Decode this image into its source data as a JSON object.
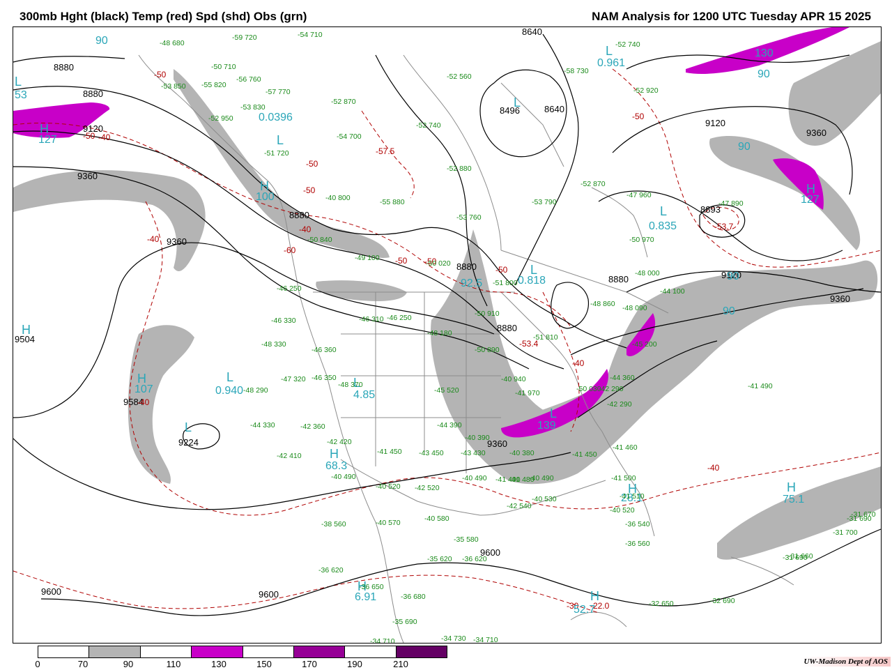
{
  "title_left": "300mb Hght (black) Temp (red) Spd (shd) Obs (grn)",
  "title_right": "NAM Analysis for 1200 UTC Tuesday  APR 15 2025",
  "credit": "UW-Madison  Dept of AOS",
  "legend": {
    "ticks": [
      "0",
      "70",
      "90",
      "110",
      "130",
      "150",
      "170",
      "190",
      "210"
    ],
    "colors": [
      "#ffffff",
      "#b4b4b4",
      "#ffffff",
      "#c800c8",
      "#ffffff",
      "#960096",
      "#ffffff",
      "#640064"
    ]
  },
  "colors": {
    "height": "#000000",
    "temp": "#b00000",
    "speed_label": "#2aa6b8",
    "obs": "#1a8a1a",
    "shade_70": "#b4b4b4",
    "shade_110": "#c800c8",
    "border": "#8c8c8c"
  },
  "height_labels": [
    "8880",
    "8880",
    "9120",
    "9360",
    "9360",
    "8880",
    "8640",
    "8496",
    "8640",
    "9120",
    "9360",
    "8880",
    "9120",
    "9360",
    "8880",
    "8880",
    "8893",
    "9600",
    "9600",
    "9600",
    "9360",
    "9224",
    "9504",
    "9584"
  ],
  "temp_labels": [
    "-50",
    "-50",
    "-50",
    "-57.5",
    "-50",
    "-50",
    "-50",
    "-40",
    "-60",
    "-40",
    "-40",
    "-50",
    "-53.4",
    "-40",
    "-40",
    "-50",
    "-53.7",
    "-40",
    "-30",
    "-22.0"
  ],
  "speed_labels": [
    "90",
    "53",
    "127",
    "100",
    "0.0396",
    "92.5",
    "0.818",
    "0.961",
    "130",
    "90",
    "90",
    "127",
    "0.835",
    "90",
    "90",
    "0.940",
    "107",
    "4.85",
    "68.3",
    "139",
    "75.1",
    "28.1",
    "52.7",
    "6.91"
  ],
  "pressure_centers": [
    "L",
    "L",
    "H",
    "H",
    "L",
    "L",
    "H",
    "L",
    "L",
    "L",
    "H",
    "H",
    "L",
    "H",
    "H",
    "L",
    "H",
    "H",
    "H",
    "L"
  ],
  "observations": [
    "-59 720",
    "-54 710",
    "-48 680",
    "-52 740",
    "-50 710",
    "-56 760",
    "-53 850",
    "-57 770",
    "-52 870",
    "-52 560",
    "-53 830",
    "-52 950",
    "-58 730",
    "-52 920",
    "-52 740",
    "-55 820",
    "-54 700",
    "-51 720",
    "-52 880",
    "-52 870",
    "-40 800",
    "-55 880",
    "-53 790",
    "-47 960",
    "-47 890",
    "-53 760",
    "-50 840",
    "-49 100",
    "-50 020",
    "-51 800",
    "-50 970",
    "-48 000",
    "-48 860",
    "-46 250",
    "-44 100",
    "-46 330",
    "-46 310",
    "-46 250",
    "-48 180",
    "-50 910",
    "-48 090",
    "-48 330",
    "-46 360",
    "-50 890",
    "-51 810",
    "-45 200",
    "-47 320",
    "-46 350",
    "-48 370",
    "-40 940",
    "-41 970",
    "-42 290",
    "-42 290",
    "-48 290",
    "-45 520",
    "-50 030",
    "-44 360",
    "-41 490",
    "-44 330",
    "-42 360",
    "-44 390",
    "-40 390",
    "-42 420",
    "-41 450",
    "-43 450",
    "-43 430",
    "-40 380",
    "-40 490",
    "-41 450",
    "-41 460",
    "-42 410",
    "-40 490",
    "-40 520",
    "-42 520",
    "-41 490",
    "-41 480",
    "-40 490",
    "-41 500",
    "-42 540",
    "-40 530",
    "-41 510",
    "-40 520",
    "-38 560",
    "-40 570",
    "-40 580",
    "-36 540",
    "-36 560",
    "-31 700",
    "-31 690",
    "-31 660",
    "-35 580",
    "-36 620",
    "-35 620",
    "-36 620",
    "-36 650",
    "-36 680",
    "-35 690",
    "-34 710",
    "-34 730",
    "-34 710",
    "-32 650",
    "-32 690",
    "-31 690",
    "-31 670"
  ]
}
